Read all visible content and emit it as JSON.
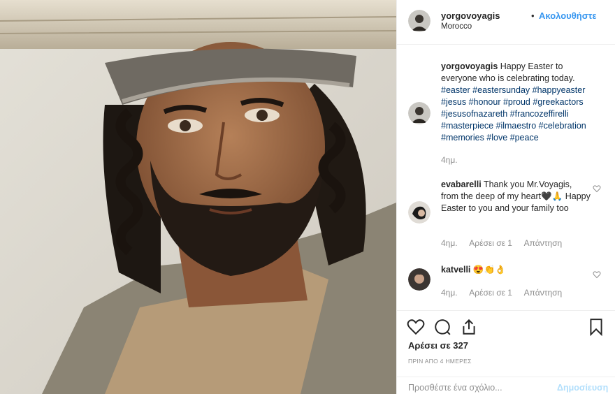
{
  "header": {
    "username": "yorgovoyagis",
    "separator": "•",
    "follow_label": "Ακολουθήστε",
    "location": "Morocco"
  },
  "caption": {
    "username": "yorgovoyagis",
    "text": "Happy Easter to everyone who is celebrating today.",
    "hashtags": "#easter #eastersunday #happyeaster #jesus #honour #proud #greekactors #jesusofnazareth #francozeffirelli #masterpiece #ilmaestro #celebration #memories #love #peace",
    "time": "4ημ."
  },
  "comments": [
    {
      "username": "evabarelli",
      "text": "Thank you Mr.Voyagis, from the deep of my heart🖤🙏 Happy Easter to you and your family too",
      "time": "4ημ.",
      "likes": "Αρέσει σε 1",
      "reply": "Απάντηση"
    },
    {
      "username": "katvelli",
      "text": "😍👏👌",
      "time": "4ημ.",
      "likes": "Αρέσει σε 1",
      "reply": "Απάντηση"
    }
  ],
  "actions": {
    "icons": [
      "heart-icon",
      "comment-icon",
      "share-icon",
      "bookmark-icon"
    ],
    "likes": "Αρέσει σε 327",
    "age": "ΠΡΙΝ ΑΠΟ 4 ΗΜΕΡΕΣ"
  },
  "add_comment": {
    "placeholder": "Προσθέστε ένα σχόλιο...",
    "post_label": "Δημοσίευση"
  },
  "colors": {
    "link": "#3897f0",
    "hashtag": "#003569",
    "muted": "#8e8e8e",
    "post_disabled": "#b2dffc",
    "border": "#efefef"
  }
}
